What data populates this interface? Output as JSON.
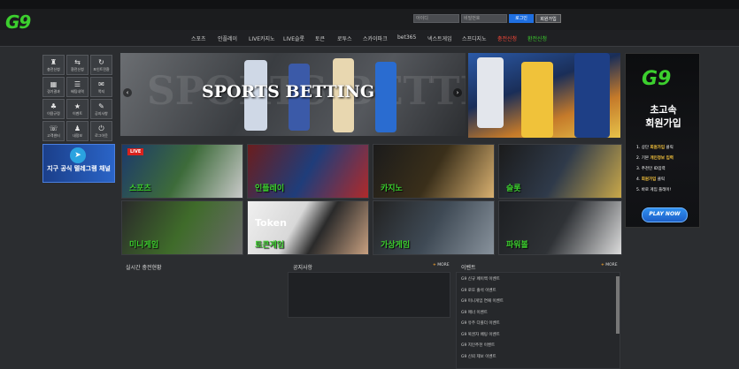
{
  "header": {
    "logo": "G9",
    "id_placeholder": "아이디",
    "pw_placeholder": "비밀번호",
    "login_label": "로그인",
    "join_label": "회원가입"
  },
  "nav": [
    {
      "label": "스포츠",
      "style": "normal"
    },
    {
      "label": "인플레이",
      "style": "normal"
    },
    {
      "label": "LIVE카지노",
      "style": "normal"
    },
    {
      "label": "LIVE슬롯",
      "style": "normal"
    },
    {
      "label": "토큰",
      "style": "normal"
    },
    {
      "label": "로투스",
      "style": "normal"
    },
    {
      "label": "스카이파크",
      "style": "normal"
    },
    {
      "label": "bet365",
      "style": "normal"
    },
    {
      "label": "넥스트게임",
      "style": "normal"
    },
    {
      "label": "스프디지노",
      "style": "normal"
    },
    {
      "label": "충전신청",
      "style": "red"
    },
    {
      "label": "환전신청",
      "style": "green"
    }
  ],
  "sidebar": [
    {
      "label": "충전신청",
      "icon": "piggy-icon",
      "glyph": "♜"
    },
    {
      "label": "환전신청",
      "icon": "exchange-icon",
      "glyph": "⇆"
    },
    {
      "label": "포인트전환",
      "icon": "convert-icon",
      "glyph": "↻"
    },
    {
      "label": "경기결과",
      "icon": "calendar-icon",
      "glyph": "▦"
    },
    {
      "label": "배팅내역",
      "icon": "list-icon",
      "glyph": "☰"
    },
    {
      "label": "쪽지",
      "icon": "mail-icon",
      "glyph": "✉"
    },
    {
      "label": "이용규정",
      "icon": "clover-icon",
      "glyph": "♣"
    },
    {
      "label": "이벤트",
      "icon": "star-icon",
      "glyph": "★"
    },
    {
      "label": "공지사항",
      "icon": "megaphone-icon",
      "glyph": "✎"
    },
    {
      "label": "고객센터",
      "icon": "headset-icon",
      "glyph": "☏"
    },
    {
      "label": "내정보",
      "icon": "user-icon",
      "glyph": "♟"
    },
    {
      "label": "로그아웃",
      "icon": "power-icon",
      "glyph": "⏻"
    }
  ],
  "telegram": {
    "text": "지구 공식 텔레그램 채널",
    "icon": "telegram-icon"
  },
  "banner": {
    "title": "SPORTS BETTING",
    "bg_text": "SPORTS BETTING"
  },
  "right_ad": {
    "logo": "G9",
    "title1": "초고속",
    "title2": "회원가입",
    "steps": [
      {
        "pre": "1. 상단 ",
        "hl": "회원가입",
        "post": " 클릭"
      },
      {
        "pre": "2. 기본 ",
        "hl": "개인정보 입력",
        "post": ""
      },
      {
        "pre": "3. 추천인 ID입력",
        "hl": "",
        "post": ""
      },
      {
        "pre": "4. ",
        "hl": "회원가입",
        "post": " 클릭"
      },
      {
        "pre": "5. 바로 게임 플레이!",
        "hl": "",
        "post": ""
      }
    ],
    "cta": "PLAY NOW"
  },
  "tiles": [
    {
      "label": "스포츠",
      "badge": "LIVE"
    },
    {
      "label": "인플레이",
      "badge": ""
    },
    {
      "label": "카지노",
      "badge": ""
    },
    {
      "label": "슬롯",
      "badge": ""
    },
    {
      "label": "미니게임",
      "badge": ""
    },
    {
      "label": "토큰게임",
      "badge": "Token"
    },
    {
      "label": "가상게임",
      "badge": ""
    },
    {
      "label": "파워볼",
      "badge": ""
    }
  ],
  "panels": {
    "charge_title": "실시간 충전현황",
    "notice_title": "공지사항",
    "event_title": "이벤트",
    "more_label": "MORE",
    "events": [
      "G9 신규 페이백 이벤트",
      "G9 로또 출석 이벤트",
      "G9 미니게임 연패 이벤트",
      "G9 매너 이벤트",
      "G9 유주 다폴더 이벤트",
      "G9 복권자 배팅 이벤트",
      "G9 지인추천 이벤트",
      "G9 신뢰 제보 이벤트"
    ]
  },
  "colors": {
    "accent": "#3ccf2e",
    "alert": "#ff4a3a",
    "login": "#1f6fe0"
  }
}
